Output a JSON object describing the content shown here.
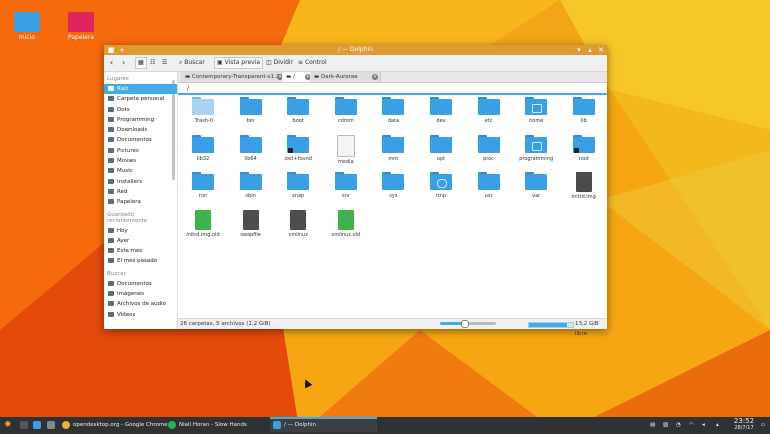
{
  "desktop": {
    "icons": [
      {
        "label": "Inicio"
      },
      {
        "label": "Papelera"
      }
    ]
  },
  "window": {
    "title": "/ — Dolphin",
    "toolbar": {
      "search": "Buscar",
      "preview": "Vista previa",
      "split": "Dividir",
      "control": "Control"
    },
    "tabs": [
      {
        "label": "Contemporary-Transparent-v1.2"
      },
      {
        "label": "/"
      },
      {
        "label": "Dark-Aurorae"
      }
    ],
    "path": "/",
    "sidebar": {
      "places_heading": "Lugares",
      "places": [
        "Raíz",
        "Carpeta personal",
        "Dots",
        "Programming",
        "Downloads",
        "Documentos",
        "Pictures",
        "Movies",
        "Music",
        "Installers",
        "Red",
        "Papelera"
      ],
      "recent_heading": "Guardado recientemente",
      "recent": [
        "Hoy",
        "Ayer",
        "Este mes",
        "El mes pasado"
      ],
      "search_heading": "Buscar",
      "search": [
        "Documentos",
        "Imágenes",
        "Archivos de audio",
        "Vídeos"
      ]
    },
    "files": [
      {
        "name": ".Trash-0",
        "kind": "trash"
      },
      {
        "name": "bin",
        "kind": "folder"
      },
      {
        "name": "boot",
        "kind": "folder"
      },
      {
        "name": "cdrom",
        "kind": "folder"
      },
      {
        "name": "data",
        "kind": "folder"
      },
      {
        "name": "dev",
        "kind": "folder"
      },
      {
        "name": "etc",
        "kind": "folder"
      },
      {
        "name": "home",
        "kind": "home"
      },
      {
        "name": "lib",
        "kind": "folder"
      },
      {
        "name": "lib32",
        "kind": "folder"
      },
      {
        "name": "lib64",
        "kind": "folder"
      },
      {
        "name": "lost+found",
        "kind": "locked"
      },
      {
        "name": "media",
        "kind": "media"
      },
      {
        "name": "mnt",
        "kind": "folder"
      },
      {
        "name": "opt",
        "kind": "folder"
      },
      {
        "name": "proc",
        "kind": "folder"
      },
      {
        "name": "programming",
        "kind": "emblem"
      },
      {
        "name": "root",
        "kind": "locked"
      },
      {
        "name": "run",
        "kind": "folder"
      },
      {
        "name": "sbin",
        "kind": "folder"
      },
      {
        "name": "snap",
        "kind": "folder"
      },
      {
        "name": "srv",
        "kind": "folder"
      },
      {
        "name": "sys",
        "kind": "folder"
      },
      {
        "name": "tmp",
        "kind": "clock"
      },
      {
        "name": "usr",
        "kind": "folder"
      },
      {
        "name": "var",
        "kind": "folder"
      },
      {
        "name": "initrd.img",
        "kind": "image"
      },
      {
        "name": "initrd.img.old",
        "kind": "green"
      },
      {
        "name": "swapfile",
        "kind": "dark"
      },
      {
        "name": "vmlinuz",
        "kind": "dark"
      },
      {
        "name": "vmlinuz.old",
        "kind": "green"
      }
    ],
    "status": {
      "summary": "26 carpetas, 5 archivos (1,2 GiB)",
      "free": "13,2 GiB libre"
    }
  },
  "taskbar": {
    "tasks": [
      {
        "label": "opendesktop.org - Google Chrome"
      },
      {
        "label": "Niall Horan - Slow Hands"
      },
      {
        "label": "/ — Dolphin"
      }
    ],
    "clock": {
      "time": "23:52",
      "date": "28/7/17"
    }
  },
  "colors": {
    "accent": "#3daee9",
    "titlebar": "#e09a34",
    "folder": "#3aa0e6",
    "taskbar": "#2f3235"
  }
}
